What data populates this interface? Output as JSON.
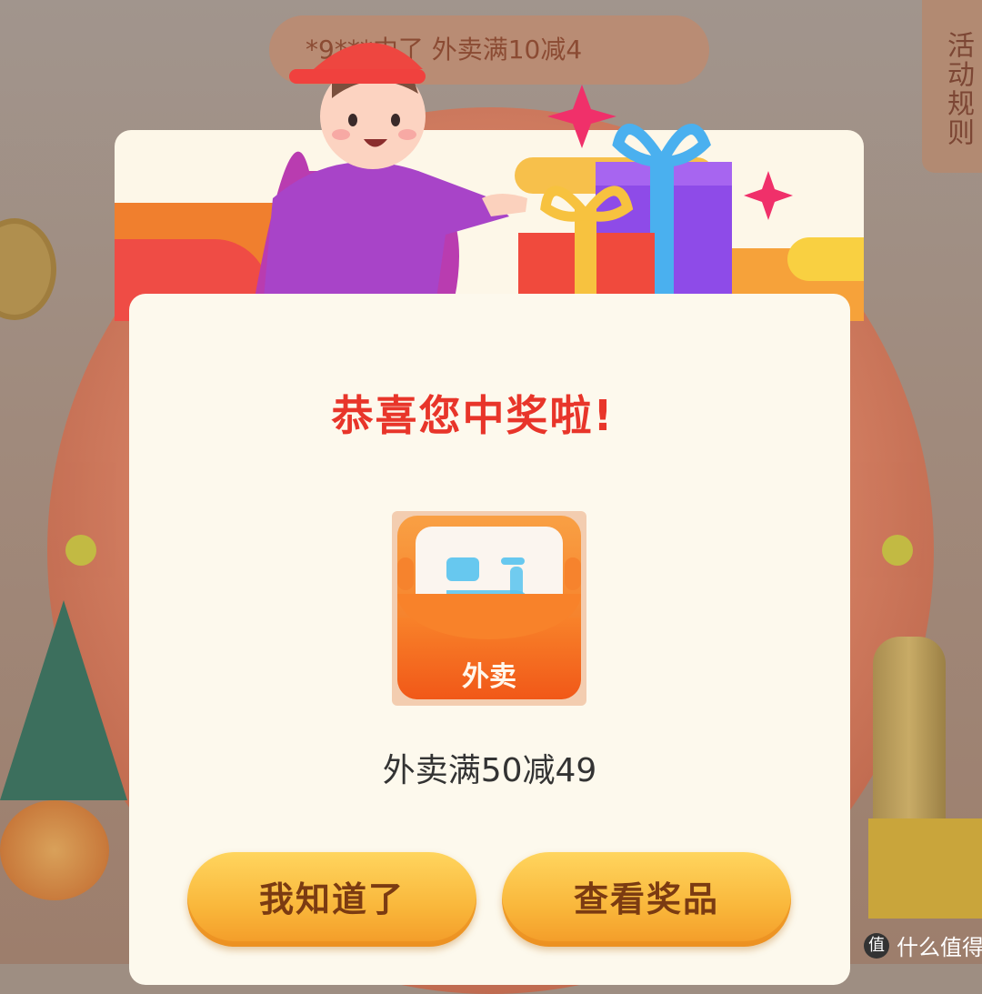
{
  "banner": {
    "text": "*9***中了  外卖满10减4"
  },
  "rules_tab": {
    "label": "活动规则"
  },
  "popup": {
    "title": "恭喜您中奖啦!",
    "prize_icon_label": "外卖",
    "prize_name": "外卖满50减49",
    "buttons": {
      "acknowledge": "我知道了",
      "view_prize": "查看奖品"
    }
  },
  "watermark": {
    "text": "什么值得买",
    "logo_glyph": "值"
  },
  "colors": {
    "title_red": "#e8352a",
    "button_gold": "#f9b63a",
    "prize_orange": "#f6832d",
    "scooter_blue": "#57c3ee"
  }
}
